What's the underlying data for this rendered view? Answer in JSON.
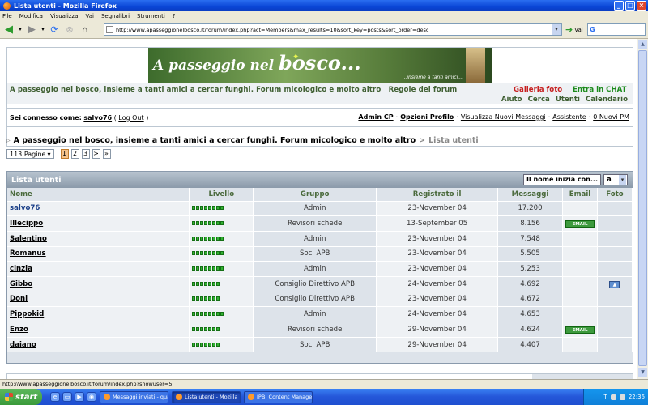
{
  "window": {
    "title": "Lista utenti - Mozilla Firefox"
  },
  "menu": [
    "File",
    "Modifica",
    "Visualizza",
    "Vai",
    "Segnalibri",
    "Strumenti",
    "?"
  ],
  "toolbar": {
    "url": "http://www.apasseggionelbosco.it/forum/index.php?act=Members&max_results=10&sort_key=posts&sort_order=desc",
    "go_label": "Vai",
    "search_value": "G"
  },
  "header": {
    "banner_title_small": "A passeggio nel",
    "banner_title_big": "bosco...",
    "banner_tagline": "...insieme a tanti amici...",
    "site_tagline": "A passeggio nel bosco, insieme a tanti amici a cercar funghi. Forum micologico e molto altro",
    "rules_link": "Regole del forum",
    "galleria": "Galleria foto",
    "chat": "Entra in CHAT",
    "nav": [
      "Aiuto",
      "Cerca",
      "Utenti",
      "Calendario"
    ]
  },
  "userbar": {
    "connected_label": "Sei connesso come:",
    "username": "salvo76",
    "logout": "Log Out",
    "open_paren": "(",
    "close_paren": ")",
    "links": [
      "Admin CP",
      "Opzioni Profilo",
      "Visualizza Nuovi Messaggi",
      "Assistente",
      "0 Nuovi PM"
    ]
  },
  "breadcrumb": {
    "forum": "A passeggio nel bosco, insieme a tanti amici a cercar funghi. Forum micologico e molto altro",
    "separator": ">",
    "current": "Lista utenti"
  },
  "pager": {
    "pages_label": "113 Pagine",
    "pages": [
      "1",
      "2",
      "3"
    ],
    "current": "1",
    "next": ">",
    "last": "»"
  },
  "members_table": {
    "title": "Lista utenti",
    "filter_label": "Il nome inizia con...",
    "filter_value": "a",
    "columns": [
      "Nome",
      "Livello",
      "Gruppo",
      "Registrato il",
      "Messaggi",
      "Email",
      "Foto"
    ],
    "email_label": "EMAIL",
    "rows": [
      {
        "name": "salvo76",
        "pips": 8,
        "group": "Admin",
        "registered": "23-November 04",
        "posts": "17.200",
        "email": false,
        "photo": false
      },
      {
        "name": "Illecippo",
        "pips": 8,
        "group": "Revisori schede",
        "registered": "13-September 05",
        "posts": "8.156",
        "email": true,
        "photo": false
      },
      {
        "name": "Salentino",
        "pips": 8,
        "group": "Admin",
        "registered": "23-November 04",
        "posts": "7.548",
        "email": false,
        "photo": false
      },
      {
        "name": "Romanus",
        "pips": 8,
        "group": "Soci APB",
        "registered": "23-November 04",
        "posts": "5.505",
        "email": false,
        "photo": false
      },
      {
        "name": "cinzia",
        "pips": 8,
        "group": "Admin",
        "registered": "23-November 04",
        "posts": "5.253",
        "email": false,
        "photo": false
      },
      {
        "name": "Gibbo",
        "pips": 7,
        "group": "Consiglio Direttivo APB",
        "registered": "24-November 04",
        "posts": "4.692",
        "email": false,
        "photo": true
      },
      {
        "name": "Doni",
        "pips": 7,
        "group": "Consiglio Direttivo APB",
        "registered": "23-November 04",
        "posts": "4.672",
        "email": false,
        "photo": false
      },
      {
        "name": "Pippokid",
        "pips": 8,
        "group": "Admin",
        "registered": "24-November 04",
        "posts": "4.653",
        "email": false,
        "photo": false
      },
      {
        "name": "Enzo",
        "pips": 7,
        "group": "Revisori schede",
        "registered": "29-November 04",
        "posts": "4.624",
        "email": true,
        "photo": false
      },
      {
        "name": "daiano",
        "pips": 7,
        "group": "Soci APB",
        "registered": "29-November 04",
        "posts": "4.407",
        "email": false,
        "photo": false
      }
    ]
  },
  "statusbar": {
    "text": "http://www.apasseggionelbosco.it/forum/index.php?showuser=5"
  },
  "taskbar": {
    "start": "start",
    "tasks": [
      "Messaggi inviati - qua...",
      "Lista utenti - Mozilla F...",
      "IPB: Content Manage..."
    ],
    "active_task": 1,
    "lang": "IT",
    "clock": "22:36"
  },
  "colors": {
    "accent_green": "#3f5f32",
    "galleria_red": "#c62020",
    "chat_green": "#1b8a1b",
    "level_pip": "#30b230"
  }
}
